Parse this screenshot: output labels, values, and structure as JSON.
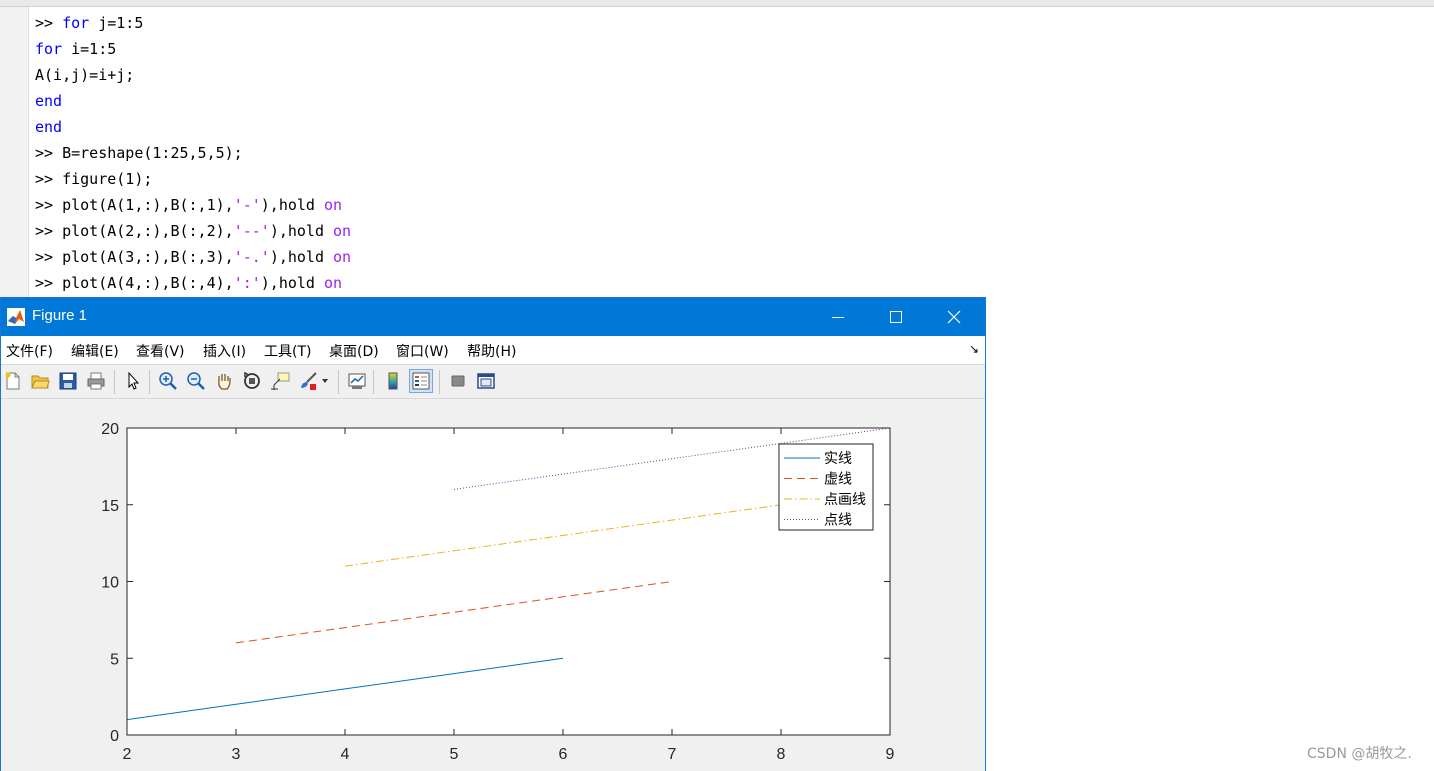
{
  "command_window": {
    "lines": [
      [
        {
          "t": ">> ",
          "c": "plain"
        },
        {
          "t": "for",
          "c": "kw"
        },
        {
          "t": " j=1:5",
          "c": "plain"
        }
      ],
      [
        {
          "t": "for",
          "c": "kw"
        },
        {
          "t": " i=1:5",
          "c": "plain"
        }
      ],
      [
        {
          "t": "A(i,j)=i+j;",
          "c": "plain"
        }
      ],
      [
        {
          "t": "end",
          "c": "kw"
        }
      ],
      [
        {
          "t": "end",
          "c": "kw"
        }
      ],
      [
        {
          "t": ">> B=reshape(1:25,5,5);",
          "c": "plain"
        }
      ],
      [
        {
          "t": ">> figure(1);",
          "c": "plain"
        }
      ],
      [
        {
          "t": ">> plot(A(1,:),B(:,1),",
          "c": "plain"
        },
        {
          "t": "'-'",
          "c": "str"
        },
        {
          "t": "),hold ",
          "c": "plain"
        },
        {
          "t": "on",
          "c": "str"
        }
      ],
      [
        {
          "t": ">> plot(A(2,:),B(:,2),",
          "c": "plain"
        },
        {
          "t": "'--'",
          "c": "str"
        },
        {
          "t": "),hold ",
          "c": "plain"
        },
        {
          "t": "on",
          "c": "str"
        }
      ],
      [
        {
          "t": ">> plot(A(3,:),B(:,3),",
          "c": "plain"
        },
        {
          "t": "'-.'",
          "c": "str"
        },
        {
          "t": "),hold ",
          "c": "plain"
        },
        {
          "t": "on",
          "c": "str"
        }
      ],
      [
        {
          "t": ">> plot(A(4,:),B(:,4),",
          "c": "plain"
        },
        {
          "t": "':'",
          "c": "str"
        },
        {
          "t": "),hold ",
          "c": "plain"
        },
        {
          "t": "on",
          "c": "str"
        }
      ]
    ]
  },
  "figure": {
    "title": "Figure 1",
    "menu": [
      "文件(F)",
      "编辑(E)",
      "查看(V)",
      "插入(I)",
      "工具(T)",
      "桌面(D)",
      "窗口(W)",
      "帮助(H)"
    ],
    "toolbar_icons": [
      "new-figure-icon",
      "open-file-icon",
      "save-icon",
      "print-icon",
      "select-arrow-icon",
      "zoom-in-icon",
      "zoom-out-icon",
      "pan-hand-icon",
      "rotate-3d-icon",
      "data-cursor-icon",
      "brush-icon",
      "brush-dropdown-icon",
      "link-plot-icon",
      "colorbar-icon",
      "legend-icon",
      "hide-plot-tools-icon",
      "show-plot-tools-icon"
    ]
  },
  "chart_data": {
    "type": "line",
    "xlim": [
      2,
      9
    ],
    "ylim": [
      0,
      20
    ],
    "xticks": [
      2,
      3,
      4,
      5,
      6,
      7,
      8,
      9
    ],
    "yticks": [
      0,
      5,
      10,
      15,
      20
    ],
    "grid": false,
    "legend_position": "top-right",
    "series": [
      {
        "name": "实线",
        "style": "solid",
        "color": "#0072bd",
        "x": [
          2,
          3,
          4,
          5,
          6
        ],
        "y": [
          1,
          2,
          3,
          4,
          5
        ]
      },
      {
        "name": "虚线",
        "style": "dashed",
        "color": "#d95319",
        "x": [
          3,
          4,
          5,
          6,
          7
        ],
        "y": [
          6,
          7,
          8,
          9,
          10
        ]
      },
      {
        "name": "点画线",
        "style": "dashdot",
        "color": "#edb120",
        "x": [
          4,
          5,
          6,
          7,
          8
        ],
        "y": [
          11,
          12,
          13,
          14,
          15
        ]
      },
      {
        "name": "点线",
        "style": "dotted",
        "color": "#7e2f8e",
        "x": [
          5,
          6,
          7,
          8,
          9
        ],
        "y": [
          16,
          17,
          18,
          19,
          20
        ]
      }
    ]
  },
  "watermark": "CSDN @胡牧之."
}
